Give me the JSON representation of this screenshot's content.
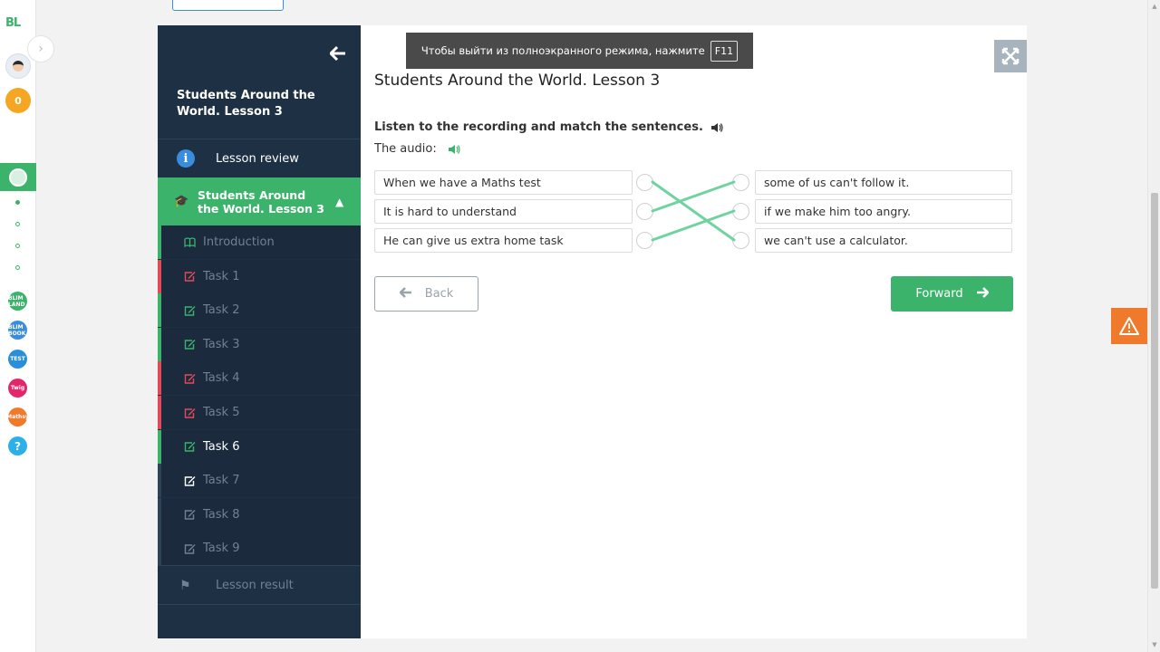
{
  "rail": {
    "logo": "BL",
    "score": "0",
    "apps": [
      {
        "name": "blim-land",
        "color": "#3bb36a",
        "label": "BLIM LAND"
      },
      {
        "name": "blim-book",
        "color": "#3a8dde",
        "label": "BLIM BOOK"
      },
      {
        "name": "blim-test",
        "color": "#2a8fd6",
        "label": "TEST"
      },
      {
        "name": "twig",
        "color": "#e3256b",
        "label": "Twig"
      },
      {
        "name": "mathsy",
        "color": "#f07a2b",
        "label": "Mathsy"
      },
      {
        "name": "help",
        "color": "#2bb0e8",
        "label": "?"
      }
    ]
  },
  "sidebar": {
    "title": "Students Around the World. Lesson 3",
    "review_label": "Lesson review",
    "lesson_label": "Students Around the World. Lesson 3",
    "items": [
      {
        "label": "Introduction",
        "status": "done",
        "bar": "#3bb36a"
      },
      {
        "label": "Task 1",
        "status": "wrong",
        "bar": "#e14a5a"
      },
      {
        "label": "Task 2",
        "status": "done",
        "bar": "#3bb36a"
      },
      {
        "label": "Task 3",
        "status": "done",
        "bar": "#3bb36a"
      },
      {
        "label": "Task 4",
        "status": "wrong",
        "bar": "#e14a5a"
      },
      {
        "label": "Task 5",
        "status": "wrong",
        "bar": "#e14a5a"
      },
      {
        "label": "Task 6",
        "status": "current",
        "bar": "#3bb36a"
      },
      {
        "label": "Task 7",
        "status": "todo",
        "bar": "#2f4357"
      },
      {
        "label": "Task 8",
        "status": "todo",
        "bar": "#2f4357"
      },
      {
        "label": "Task 9",
        "status": "todo",
        "bar": "#2f4357"
      }
    ],
    "result_label": "Lesson result"
  },
  "fullscreen_notice": {
    "text": "Чтобы выйти из полноэкранного режима, нажмите",
    "key": "F11"
  },
  "content": {
    "title": "Students Around the World. Lesson 3",
    "instruction": "Listen to the recording and match the sentences.",
    "audio_label": "The audio:",
    "left": [
      "When we have a Maths test",
      "It is hard to understand",
      "He can give us extra home task"
    ],
    "right": [
      "some of us can't follow it.",
      "if we make him too angry.",
      "we can't use a calculator."
    ],
    "matches": [
      [
        0,
        2
      ],
      [
        1,
        0
      ],
      [
        2,
        1
      ]
    ],
    "back_label": "Back",
    "forward_label": "Forward"
  },
  "colors": {
    "accent": "#3bb36a",
    "sidebar_bg": "#1e3044",
    "wrong": "#e14a5a",
    "warning": "#f07a2b"
  }
}
